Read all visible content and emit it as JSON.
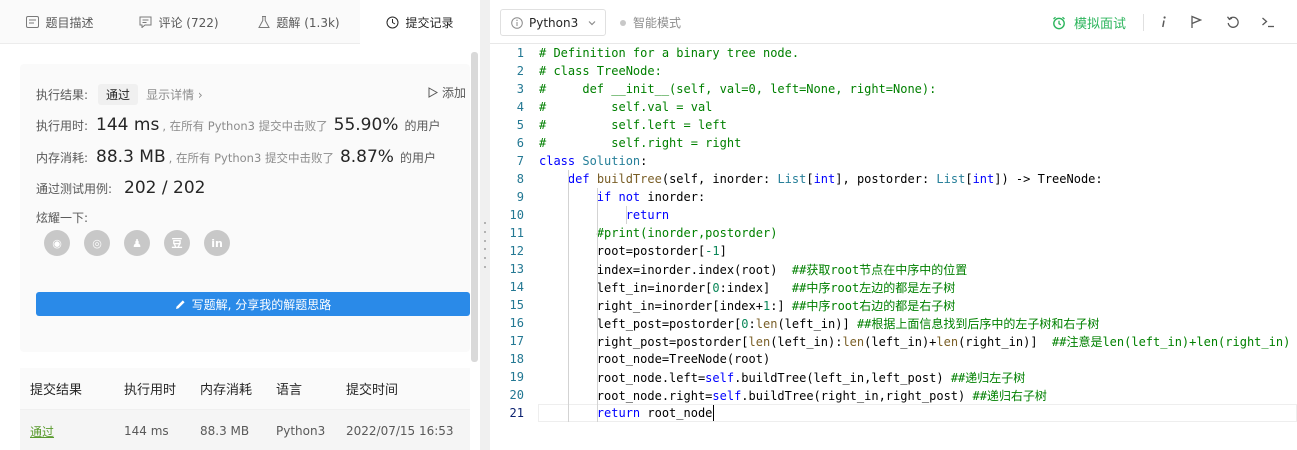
{
  "tabs": [
    {
      "label": "题目描述",
      "icon": "description-icon"
    },
    {
      "label": "评论 (722)",
      "icon": "comment-icon"
    },
    {
      "label": "题解 (1.3k)",
      "icon": "flask-icon"
    },
    {
      "label": "提交记录",
      "icon": "clock-icon",
      "active": true
    }
  ],
  "result": {
    "status_label": "执行结果:",
    "status_value": "通过",
    "show_detail": "显示详情 ›",
    "add_note": "添加",
    "time_label": "执行用时:",
    "time_value": "144 ms",
    "time_text": ", 在所有 Python3 提交中击败了",
    "time_pct": "55.90%",
    "time_suffix": "的用户",
    "mem_label": "内存消耗:",
    "mem_value": "88.3 MB",
    "mem_text": ", 在所有 Python3 提交中击败了",
    "mem_pct": "8.87%",
    "mem_suffix": "的用户",
    "tests_label": "通过测试用例:",
    "tests_value": "202 / 202",
    "share_label": "炫耀一下:",
    "share_icons": [
      "wechat-icon",
      "weibo-icon",
      "qq-icon",
      "douban-icon",
      "linkedin-icon"
    ],
    "share_glyphs": [
      "◉",
      "◎",
      "♟",
      "豆",
      "in"
    ],
    "write_button": "写题解, 分享我的解题思路"
  },
  "submissions": {
    "headers": [
      "提交结果",
      "执行用时",
      "内存消耗",
      "语言",
      "提交时间"
    ],
    "rows": [
      [
        "通过",
        "144 ms",
        "88.3 MB",
        "Python3",
        "2022/07/15 16:53"
      ]
    ]
  },
  "toolbar": {
    "language": "Python3",
    "smart_mode": "智能模式",
    "mock_interview": "模拟面试",
    "icons": [
      "info-icon",
      "flag-icon",
      "reset-icon",
      "console-icon"
    ],
    "accent": "#2db55d"
  },
  "editor": {
    "lines": [
      [
        [
          "cm",
          "# Definition for a binary tree node."
        ]
      ],
      [
        [
          "cm",
          "# class TreeNode:"
        ]
      ],
      [
        [
          "cm",
          "#     def __init__(self, val=0, left=None, right=None):"
        ]
      ],
      [
        [
          "cm",
          "#         self.val = val"
        ]
      ],
      [
        [
          "cm",
          "#         self.left = left"
        ]
      ],
      [
        [
          "cm",
          "#         self.right = right"
        ]
      ],
      [
        [
          "kw",
          "class "
        ],
        [
          "cl",
          "Solution"
        ],
        [
          "tx",
          ":"
        ]
      ],
      [
        [
          "tx",
          "    "
        ],
        [
          "kw",
          "def "
        ],
        [
          "fn",
          "buildTree"
        ],
        [
          "tx",
          "(self, inorder: "
        ],
        [
          "ty",
          "List"
        ],
        [
          "tx",
          "["
        ],
        [
          "kw",
          "int"
        ],
        [
          "tx",
          "], postorder: "
        ],
        [
          "ty",
          "List"
        ],
        [
          "tx",
          "["
        ],
        [
          "kw",
          "int"
        ],
        [
          "tx",
          "]) -> TreeNode:"
        ]
      ],
      [
        [
          "tx",
          "        "
        ],
        [
          "kw",
          "if not "
        ],
        [
          "tx",
          "inorder:"
        ]
      ],
      [
        [
          "tx",
          "            "
        ],
        [
          "kw",
          "return"
        ]
      ],
      [
        [
          "tx",
          "        "
        ],
        [
          "cm",
          "#print(inorder,postorder)"
        ]
      ],
      [
        [
          "tx",
          "        root=postorder["
        ],
        [
          "num",
          "-1"
        ],
        [
          "tx",
          "]"
        ]
      ],
      [
        [
          "tx",
          "        index=inorder.index(root)  "
        ],
        [
          "cm",
          "##获取root节点在中序中的位置"
        ]
      ],
      [
        [
          "tx",
          "        left_in=inorder["
        ],
        [
          "num",
          "0"
        ],
        [
          "tx",
          ":index]   "
        ],
        [
          "cm",
          "##中序root左边的都是左子树"
        ]
      ],
      [
        [
          "tx",
          "        right_in=inorder[index+"
        ],
        [
          "num",
          "1"
        ],
        [
          "tx",
          ":] "
        ],
        [
          "cm",
          "##中序root右边的都是右子树"
        ]
      ],
      [
        [
          "tx",
          "        left_post=postorder["
        ],
        [
          "num",
          "0"
        ],
        [
          "tx",
          ":"
        ],
        [
          "fn",
          "len"
        ],
        [
          "tx",
          "(left_in)] "
        ],
        [
          "cm",
          "##根据上面信息找到后序中的左子树和右子树"
        ]
      ],
      [
        [
          "tx",
          "        right_post=postorder["
        ],
        [
          "fn",
          "len"
        ],
        [
          "tx",
          "(left_in):"
        ],
        [
          "fn",
          "len"
        ],
        [
          "tx",
          "(left_in)+"
        ],
        [
          "fn",
          "len"
        ],
        [
          "tx",
          "(right_in)]  "
        ],
        [
          "cm",
          "##注意是len(left_in)+len(right_in)"
        ]
      ],
      [
        [
          "tx",
          "        root_node=TreeNode(root)"
        ]
      ],
      [
        [
          "tx",
          "        root_node.left="
        ],
        [
          "kw",
          "self"
        ],
        [
          "tx",
          ".buildTree(left_in,left_post) "
        ],
        [
          "cm",
          "##递归左子树"
        ]
      ],
      [
        [
          "tx",
          "        root_node.right="
        ],
        [
          "kw",
          "self"
        ],
        [
          "tx",
          ".buildTree(right_in,right_post) "
        ],
        [
          "cm",
          "##递归右子树"
        ]
      ],
      [
        [
          "tx",
          "        "
        ],
        [
          "kw",
          "return "
        ],
        [
          "tx",
          "root_node"
        ]
      ]
    ]
  }
}
